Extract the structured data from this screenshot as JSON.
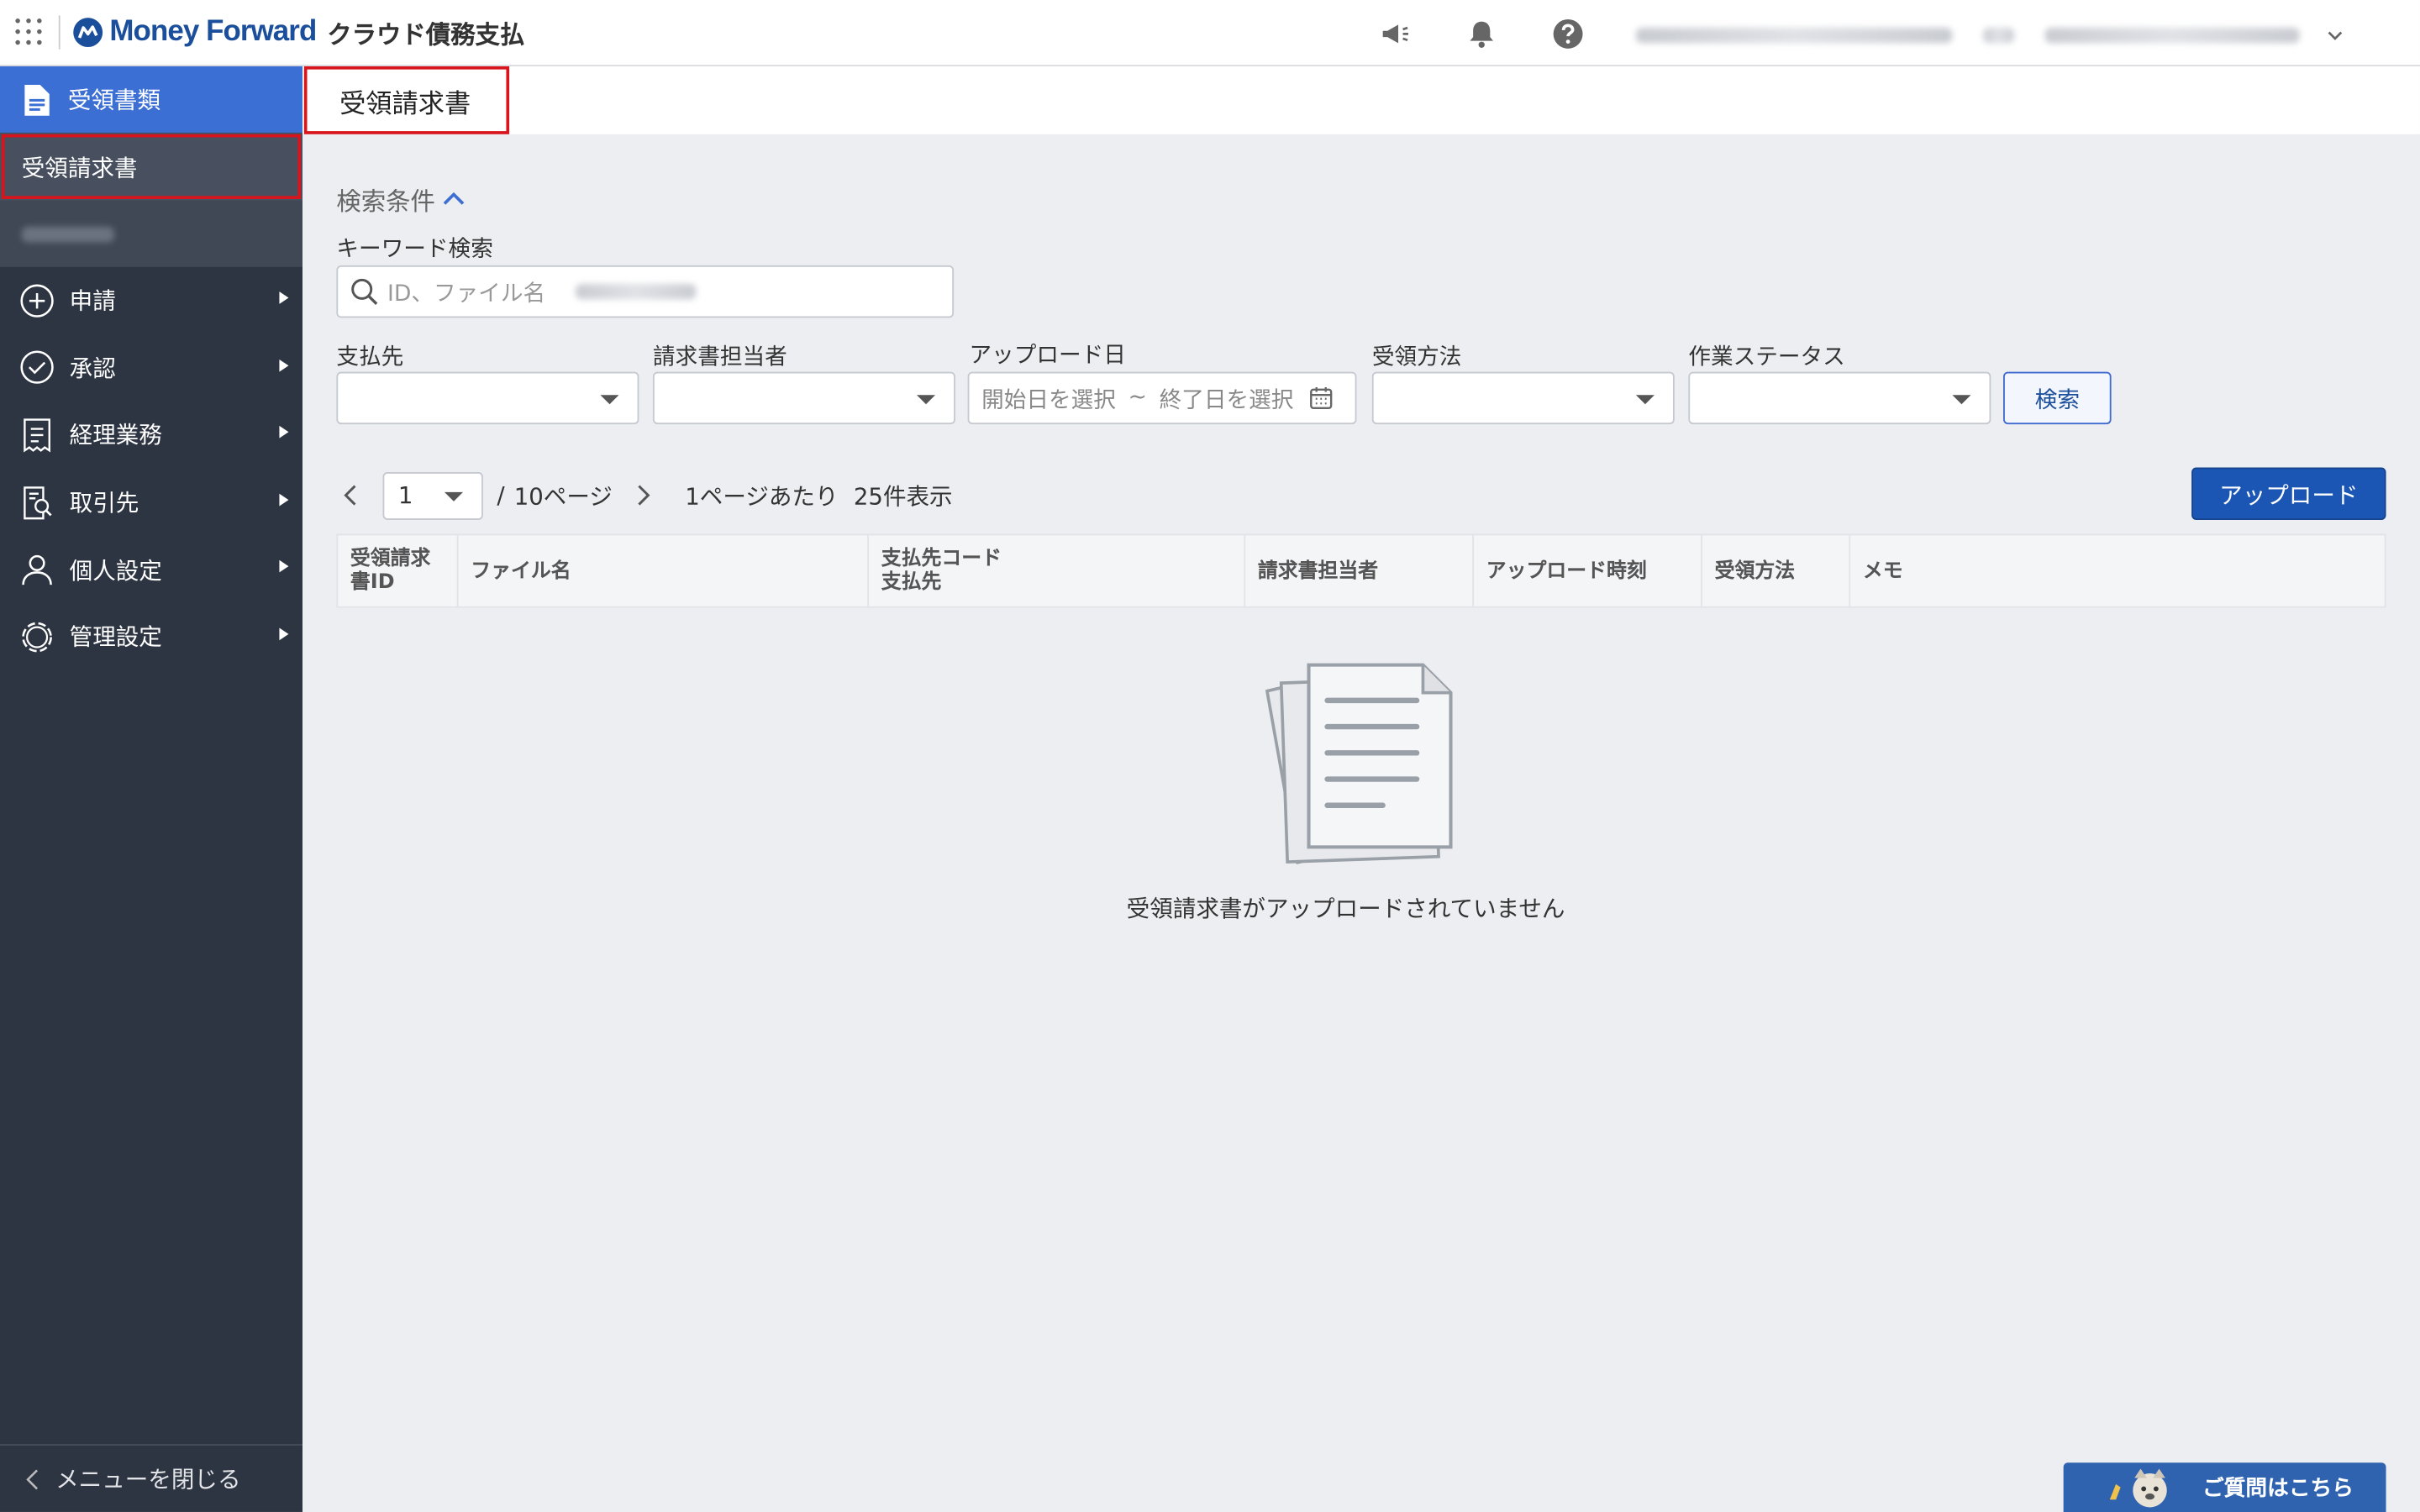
{
  "header": {
    "logo_text": "Money Forward",
    "product_name": "クラウド債務支払"
  },
  "sidebar": {
    "section_label": "受領書類",
    "active_item": "受領請求書",
    "items": [
      {
        "label": "申請",
        "icon": "plus-circle-icon"
      },
      {
        "label": "承認",
        "icon": "check-circle-icon"
      },
      {
        "label": "経理業務",
        "icon": "receipt-icon"
      },
      {
        "label": "取引先",
        "icon": "vendor-icon"
      },
      {
        "label": "個人設定",
        "icon": "person-icon"
      },
      {
        "label": "管理設定",
        "icon": "gear-icon"
      }
    ],
    "close_label": "メニューを閉じる"
  },
  "page": {
    "title": "受領請求書"
  },
  "search": {
    "section_title": "検索条件",
    "keyword_label": "キーワード検索",
    "keyword_placeholder": "ID、ファイル名",
    "filters": [
      {
        "label": "支払先",
        "value": ""
      },
      {
        "label": "請求書担当者",
        "value": ""
      },
      {
        "label": "アップロード日",
        "start_placeholder": "開始日を選択",
        "separator": "~",
        "end_placeholder": "終了日を選択"
      },
      {
        "label": "受領方法",
        "value": ""
      },
      {
        "label": "作業ステータス",
        "value": ""
      }
    ],
    "search_button": "検索"
  },
  "pagination": {
    "current_page": "1",
    "total_text": "10ページ",
    "separator": "/",
    "per_page_label": "1ページあたり",
    "per_page_value": "25件表示"
  },
  "upload_button": "アップロード",
  "table": {
    "columns": [
      {
        "line1": "受領請求",
        "line2": "書ID"
      },
      {
        "line1": "ファイル名",
        "line2": ""
      },
      {
        "line1": "支払先コード",
        "line2": "支払先"
      },
      {
        "line1": "請求書担当者",
        "line2": ""
      },
      {
        "line1": "アップロード時刻",
        "line2": ""
      },
      {
        "line1": "受領方法",
        "line2": ""
      },
      {
        "line1": "メモ",
        "line2": ""
      }
    ],
    "empty_message": "受領請求書がアップロードされていません"
  },
  "help_button": "ご質問はこちら",
  "colors": {
    "brand_blue": "#1b4f9c",
    "sidebar_bg": "#2e3542",
    "sidebar_active": "#3c6fd4",
    "highlight_red": "#d8141c",
    "primary_button": "#1b56b5"
  }
}
